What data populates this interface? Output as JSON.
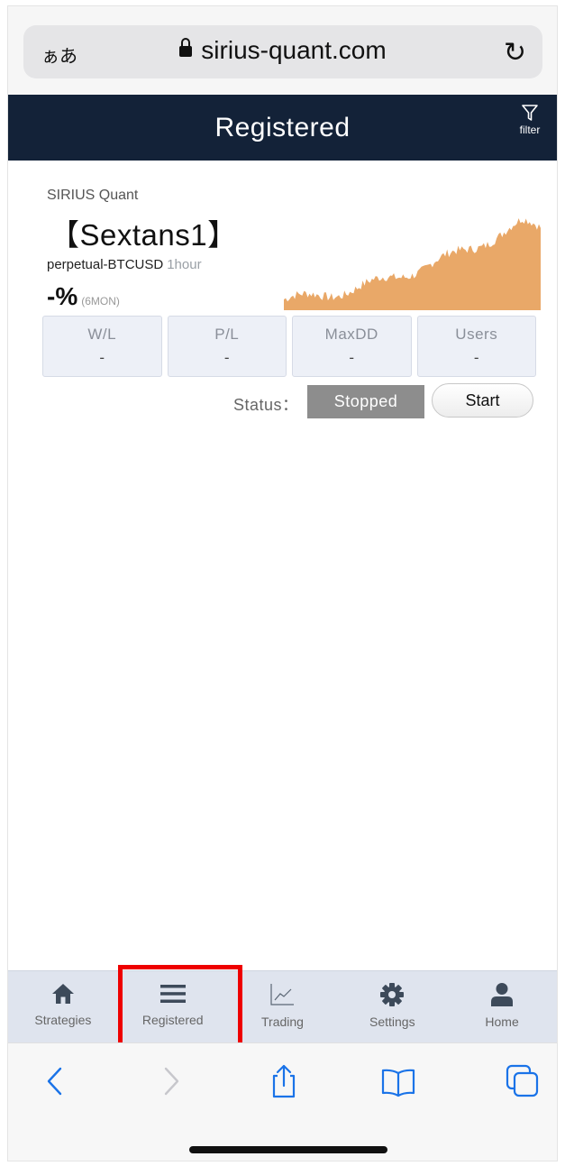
{
  "browser": {
    "text_size_label": "ぁあ",
    "url": "sirius-quant.com"
  },
  "header": {
    "title": "Registered",
    "filter_label": "filter"
  },
  "strategy_card": {
    "brand": "SIRIUS Quant",
    "name": "【Sextans1】",
    "pair": "perpetual-BTCUSD",
    "timeframe": "1hour",
    "return_pct": "-%",
    "return_period": "(6MON)",
    "chart_color": "#e9a868",
    "stats": [
      {
        "label": "W/L",
        "value": "-"
      },
      {
        "label": "P/L",
        "value": "-"
      },
      {
        "label": "MaxDD",
        "value": "-"
      },
      {
        "label": "Users",
        "value": "-"
      }
    ],
    "status_label": "Status：",
    "status_value": "Stopped",
    "start_button": "Start"
  },
  "tabbar": {
    "items": [
      {
        "label": "Strategies",
        "icon": "home-icon"
      },
      {
        "label": "Registered",
        "icon": "list-icon",
        "highlighted": true
      },
      {
        "label": "Trading",
        "icon": "line-chart-icon"
      },
      {
        "label": "Settings",
        "icon": "gear-icon"
      },
      {
        "label": "Home",
        "icon": "user-icon"
      }
    ]
  },
  "colors": {
    "header_bg": "#132238",
    "accent_chart": "#e9a868",
    "highlight_box": "#ee0000",
    "browser_blue": "#1a73e8"
  }
}
